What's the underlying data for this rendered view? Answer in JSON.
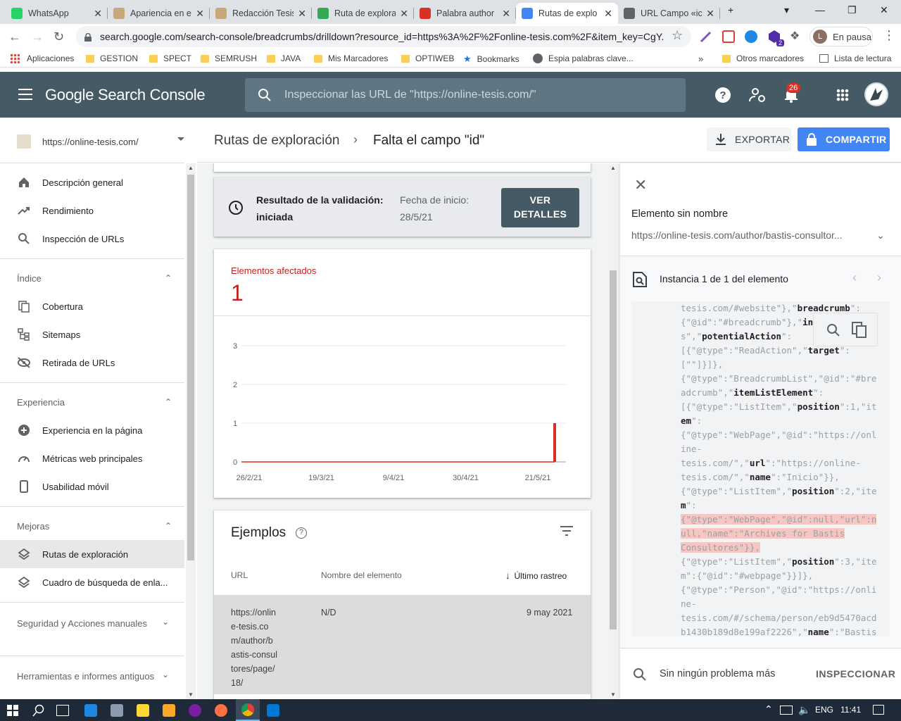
{
  "browser": {
    "tabs": [
      {
        "title": "WhatsApp",
        "color": "#25d366"
      },
      {
        "title": "Apariencia en e",
        "color": "#c8a878"
      },
      {
        "title": "Redacción Tesis",
        "color": "#c8a878"
      },
      {
        "title": "Ruta de explora",
        "color": "#34a853"
      },
      {
        "title": "Palabra author",
        "color": "#d93025"
      },
      {
        "title": "Rutas de explo",
        "color": "#4285f4"
      },
      {
        "title": "URL Campo «ic",
        "color": "#5f6368"
      }
    ],
    "url": "search.google.com/search-console/breadcrumbs/drilldown?resource_id=https%3A%2F%2Fonline-tesis.com%2F&item_key=CgY...",
    "profile_label": "En pausa",
    "profile_initial": "L",
    "bookmarks": [
      "Aplicaciones",
      "GESTION",
      "SPECT",
      "SEMRUSH",
      "JAVA",
      "Mis Marcadores",
      "OPTIWEB",
      "Bookmarks",
      "Espia palabras clave...",
      "Otros marcadores",
      "Lista de lectura"
    ],
    "ext_badge": "2"
  },
  "gsc": {
    "brand": "Google Search Console",
    "search_placeholder": "Inspeccionar las URL de \"https://online-tesis.com/\"",
    "notifications": "26",
    "property": "https://online-tesis.com/"
  },
  "nav": {
    "items_top": [
      "Descripción general",
      "Rendimiento",
      "Inspección de URLs"
    ],
    "indice": {
      "title": "Índice",
      "items": [
        "Cobertura",
        "Sitemaps",
        "Retirada de URLs"
      ]
    },
    "experiencia": {
      "title": "Experiencia",
      "items": [
        "Experiencia en la página",
        "Métricas web principales",
        "Usabilidad móvil"
      ]
    },
    "mejoras": {
      "title": "Mejoras",
      "items": [
        "Rutas de exploración",
        "Cuadro de búsqueda de enla..."
      ]
    },
    "seguridad": "Seguridad y Acciones manuales",
    "herramientas": "Herramientas e informes antiguos"
  },
  "page": {
    "crumb_parent": "Rutas de exploración",
    "crumb_current": "Falta el campo \"id\"",
    "export": "EXPORTAR",
    "share": "COMPARTIR"
  },
  "validation": {
    "label": "Resultado de la validación:",
    "status": "iniciada",
    "date_label": "Fecha de inicio:",
    "date": "28/5/21",
    "button_line1": "VER",
    "button_line2": "DETALLES"
  },
  "affected": {
    "label": "Elementos afectados",
    "count": "1"
  },
  "chart_data": {
    "type": "bar",
    "title": "",
    "xlabel": "",
    "ylabel": "",
    "ylim": [
      0,
      3
    ],
    "yticks": [
      "0",
      "1",
      "2",
      "3"
    ],
    "xticks": [
      "26/2/21",
      "19/3/21",
      "9/4/21",
      "30/4/21",
      "21/5/21"
    ],
    "series": [
      {
        "values": [
          0,
          0,
          0,
          0,
          1
        ]
      }
    ],
    "color": "#d93025",
    "grid": true
  },
  "examples": {
    "title": "Ejemplos",
    "col_url": "URL",
    "col_name": "Nombre del elemento",
    "col_date": "Último rastreo",
    "rows": [
      {
        "url_lines": [
          "https://onlin",
          "e-tesis.co",
          "m/author/b",
          "astis-consul",
          "tores/page/",
          "18/"
        ],
        "name": "N/D",
        "date": "9 may 2021"
      }
    ]
  },
  "panel": {
    "item_title": "Elemento sin nombre",
    "item_url": "https://online-tesis.com/author/bastis-consultor...",
    "instance": "Instancia 1 de 1 del elemento",
    "inspect_text": "Sin ningún problema más",
    "inspect_button": "INSPECCIONAR"
  },
  "code_lines": [
    [
      "tesis.com/#website\"},\"",
      "breadcrumb",
      "\":"
    ],
    [
      "{\"@id\":\"#breadcrumb\"},\"",
      "inLangu",
      ""
    ],
    [
      "s\",\"",
      "potentialAction",
      "\":"
    ],
    [
      "[{\"@type\":\"ReadAction\",\"",
      "target",
      "\":"
    ],
    [
      "[\"\"]}]},",
      "",
      ""
    ],
    [
      "{\"@type\":\"BreadcrumbList\",\"@id\":\"#bre",
      "",
      ""
    ],
    [
      "adcrumb\",\"",
      "itemListElement",
      "\":"
    ],
    [
      "[{\"@type\":\"ListItem\",\"",
      "position",
      "\":1,\"it"
    ],
    [
      "",
      "em",
      "\":"
    ],
    [
      "{\"@type\":\"WebPage\",\"@id\":\"https://onl",
      "",
      ""
    ],
    [
      "ine-",
      "",
      ""
    ],
    [
      "tesis.com/\",\"",
      "url",
      "\":\"https://online-"
    ],
    [
      "tesis.com/\",\"",
      "name",
      "\":\"Inicio\"}},"
    ],
    [
      "{\"@type\":\"ListItem\",\"",
      "position",
      "\":2,\"ite"
    ],
    [
      "",
      "m",
      "\":"
    ],
    [
      "{\"@type\":\"WebPage\",\"@id\":null,\"url\":n",
      "",
      ""
    ],
    [
      "ull,\"name\":\"Archives for Bastis",
      "",
      ""
    ],
    [
      "Consultores\"}},",
      "",
      ""
    ],
    [
      "{\"@type\":\"ListItem\",\"",
      "position",
      "\":3,\"ite"
    ],
    [
      "m\":{\"@id\":\"#webpage\"}}]},",
      "",
      ""
    ],
    [
      "{\"@type\":\"Person\",\"@id\":\"https://onli",
      "",
      ""
    ],
    [
      "ne-",
      "",
      ""
    ],
    [
      "tesis.com/#/schema/person/eb9d5470acd",
      "",
      ""
    ],
    [
      "b1430b189d8e199af2226\",\"",
      "name",
      "\":\"Bastis"
    ]
  ],
  "taskbar": {
    "lang": "ENG",
    "time": "11:41"
  }
}
